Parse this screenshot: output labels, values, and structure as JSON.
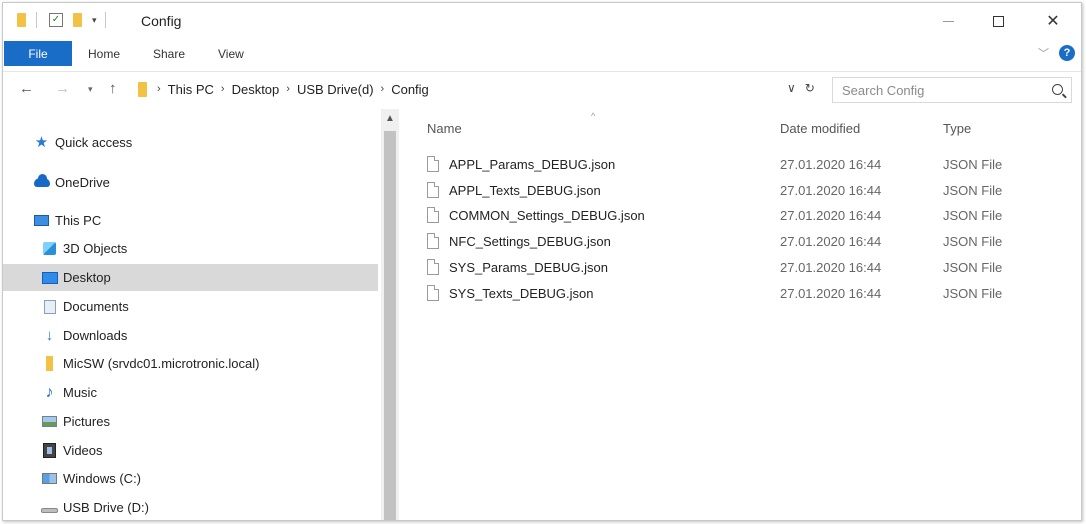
{
  "window": {
    "title": "Config"
  },
  "ribbon": {
    "tabs": [
      "File",
      "Home",
      "Share",
      "View"
    ],
    "help_label": "?"
  },
  "address": {
    "breadcrumb": [
      "This PC",
      "Desktop",
      "USB Drive(d)",
      "Config"
    ]
  },
  "search": {
    "placeholder": "Search Config"
  },
  "sidebar": {
    "items": [
      {
        "label": "Quick access",
        "icon": "star-icon"
      },
      {
        "label": "OneDrive",
        "icon": "cloud-icon"
      },
      {
        "label": "This PC",
        "icon": "monitor-icon"
      },
      {
        "label": "3D Objects",
        "icon": "cube-icon"
      },
      {
        "label": "Desktop",
        "icon": "desktop-icon",
        "selected": true
      },
      {
        "label": "Documents",
        "icon": "document-icon"
      },
      {
        "label": "Downloads",
        "icon": "download-icon"
      },
      {
        "label": "MicSW (srvdc01.microtronic.local)",
        "icon": "network-drive-icon"
      },
      {
        "label": "Music",
        "icon": "music-icon"
      },
      {
        "label": "Pictures",
        "icon": "pictures-icon"
      },
      {
        "label": "Videos",
        "icon": "videos-icon"
      },
      {
        "label": "Windows (C:)",
        "icon": "windows-drive-icon"
      },
      {
        "label": "USB Drive (D:)",
        "icon": "usb-drive-icon"
      }
    ]
  },
  "columns": {
    "name": "Name",
    "date": "Date modified",
    "type": "Type"
  },
  "files": [
    {
      "name": "APPL_Params_DEBUG.json",
      "date": "27.01.2020 16:44",
      "type": "JSON File"
    },
    {
      "name": "APPL_Texts_DEBUG.json",
      "date": "27.01.2020 16:44",
      "type": "JSON File"
    },
    {
      "name": "COMMON_Settings_DEBUG.json",
      "date": "27.01.2020 16:44",
      "type": "JSON File"
    },
    {
      "name": "NFC_Settings_DEBUG.json",
      "date": "27.01.2020 16:44",
      "type": "JSON File"
    },
    {
      "name": "SYS_Params_DEBUG.json",
      "date": "27.01.2020 16:44",
      "type": "JSON File"
    },
    {
      "name": "SYS_Texts_DEBUG.json",
      "date": "27.01.2020 16:44",
      "type": "JSON File"
    }
  ],
  "colors": {
    "accent": "#1a6dc6",
    "folder": "#f2c244",
    "selected_bg": "#d9d9d9"
  }
}
